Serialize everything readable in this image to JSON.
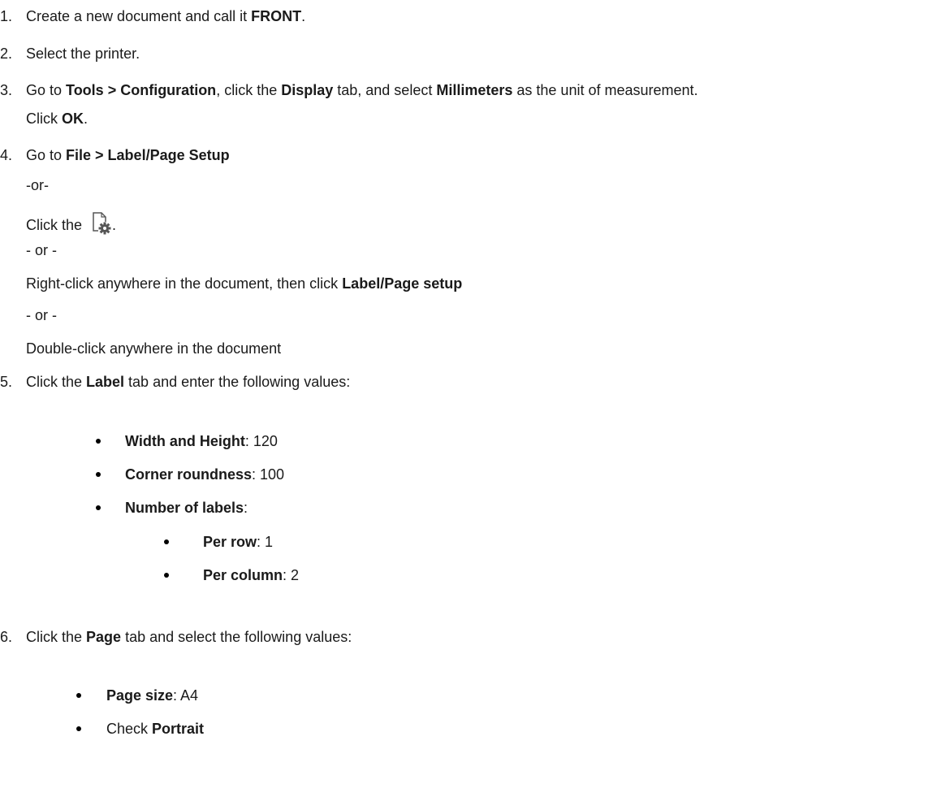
{
  "steps": {
    "s1": {
      "num": "1.",
      "pre": "Create a new document and call it ",
      "b1": "FRONT",
      "post": "."
    },
    "s2": {
      "num": "2.",
      "text": "Select the printer."
    },
    "s3": {
      "num": "3.",
      "pre": "Go to ",
      "b1": "Tools > Configuration",
      "mid1": ", click the ",
      "b2": "Display",
      "mid2": " tab, and select ",
      "b3": "Millimeters",
      "post": " as the unit of measurement.",
      "l2_pre": "Click ",
      "l2_b": "OK",
      "l2_post": "."
    },
    "s4": {
      "num": "4.",
      "pre": "Go to ",
      "b1": "File > Label/Page Setup",
      "or1": "-or-",
      "click_pre": "Click the ",
      "click_post": ".",
      "or2": "- or -",
      "rc_pre": "Right-click anywhere in the document, then click ",
      "rc_b": "Label/Page setup",
      "or3": "- or -",
      "dbl": "Double-click anywhere in the document",
      "icon": "page-setup-gear-icon"
    },
    "s5": {
      "num": "5.",
      "pre": "Click the ",
      "b1": "Label",
      "post": " tab and enter the following values:",
      "items": [
        {
          "label": "Width and Height",
          "value": ": 120"
        },
        {
          "label": "Corner roundness",
          "value": ": 100"
        },
        {
          "label": "Number of labels",
          "value": ":"
        }
      ],
      "subitems": [
        {
          "label": "Per row",
          "value": ": 1"
        },
        {
          "label": "Per column",
          "value": ": 2"
        }
      ]
    },
    "s6": {
      "num": "6.",
      "pre": "Click the ",
      "b1": "Page",
      "post": " tab and select the following values:",
      "items": [
        {
          "label": "Page size",
          "value": ": A4"
        },
        {
          "pre": "Check ",
          "label": "Portrait"
        }
      ]
    }
  }
}
